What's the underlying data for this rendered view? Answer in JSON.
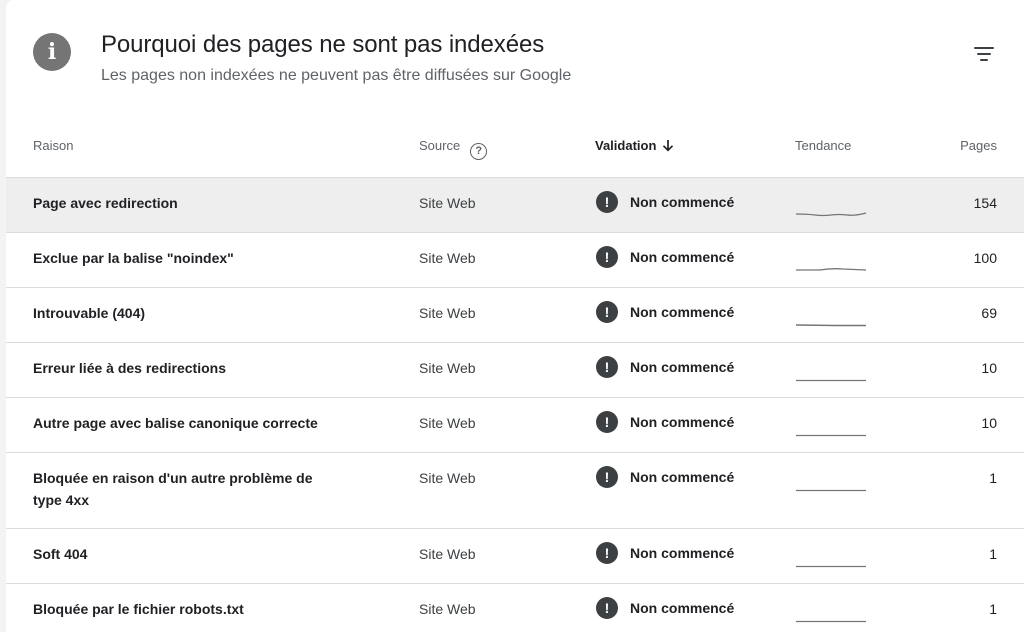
{
  "header": {
    "title": "Pourquoi des pages ne sont pas indexées",
    "subtitle": "Les pages non indexées ne peuvent pas être diffusées sur Google",
    "info_icon": "info-icon",
    "filter_icon": "filter-icon"
  },
  "columns": {
    "raison": "Raison",
    "source": "Source",
    "validation": "Validation",
    "tendance": "Tendance",
    "pages": "Pages"
  },
  "rows": [
    {
      "raison": "Page avec redirection",
      "source": "Site Web",
      "validation": "Non commencé",
      "pages": "154"
    },
    {
      "raison": "Exclue par la balise \"noindex\"",
      "source": "Site Web",
      "validation": "Non commencé",
      "pages": "100"
    },
    {
      "raison": "Introuvable (404)",
      "source": "Site Web",
      "validation": "Non commencé",
      "pages": "69"
    },
    {
      "raison": "Erreur liée à des redirections",
      "source": "Site Web",
      "validation": "Non commencé",
      "pages": "10"
    },
    {
      "raison": "Autre page avec balise canonique correcte",
      "source": "Site Web",
      "validation": "Non commencé",
      "pages": "10"
    },
    {
      "raison": "Bloquée en raison d'un autre problème de type 4xx",
      "source": "Site Web",
      "validation": "Non commencé",
      "pages": "1"
    },
    {
      "raison": "Soft 404",
      "source": "Site Web",
      "validation": "Non commencé",
      "pages": "1"
    },
    {
      "raison": "Bloquée par le fichier robots.txt",
      "source": "Site Web",
      "validation": "Non commencé",
      "pages": "1"
    }
  ],
  "colors": {
    "accent": "#202124",
    "muted": "#5f6368",
    "highlight_row": "#eeeeee",
    "divider": "#dadce0",
    "trend_line": "#757575"
  }
}
